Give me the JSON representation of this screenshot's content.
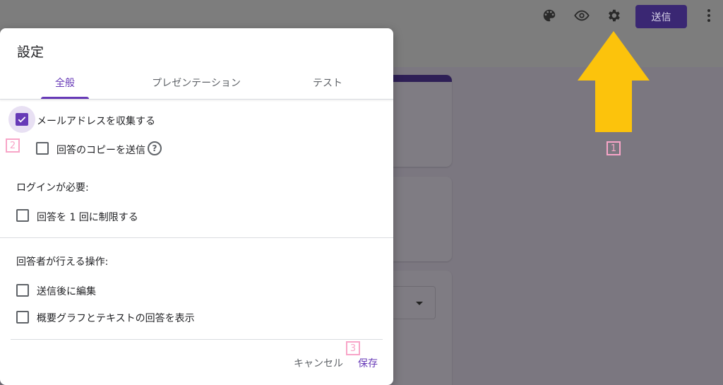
{
  "header": {
    "send_label": "送信",
    "icons": [
      "palette-icon",
      "eye-icon",
      "gear-icon",
      "more-vert-icon"
    ]
  },
  "annotations": {
    "marker_1": "1",
    "marker_2": "2",
    "marker_3": "3"
  },
  "dialog": {
    "title": "設定",
    "tabs": [
      {
        "label": "全般",
        "active": true
      },
      {
        "label": "プレゼンテーション",
        "active": false
      },
      {
        "label": "テスト",
        "active": false
      }
    ],
    "options": {
      "collect_email": {
        "label": "メールアドレスを収集する",
        "checked": true
      },
      "send_copy": {
        "label": "回答のコピーを送信",
        "checked": false
      }
    },
    "login_section": {
      "title": "ログインが必要:",
      "limit_one": {
        "label": "回答を 1 回に制限する",
        "checked": false
      }
    },
    "respondent_section": {
      "title": "回答者が行える操作:",
      "edit_after": {
        "label": "送信後に編集",
        "checked": false
      },
      "view_summary": {
        "label": "概要グラフとテキストの回答を表示",
        "checked": false
      }
    },
    "actions": {
      "cancel": "キャンセル",
      "save": "保存"
    }
  },
  "colors": {
    "accent": "#673ab7",
    "arrow": "#fcc30c",
    "marker": "#f8a5c8",
    "send_button": "#3a2773"
  }
}
